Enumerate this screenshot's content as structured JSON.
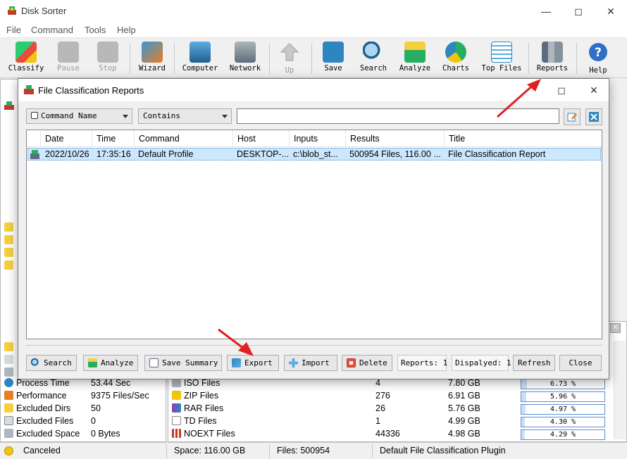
{
  "window": {
    "title": "Disk Sorter"
  },
  "menu": [
    "File",
    "Command",
    "Tools",
    "Help"
  ],
  "toolbar": [
    {
      "label": "Classify",
      "icon": "classify-icon",
      "enabled": true
    },
    {
      "label": "Pause",
      "icon": "pause-icon",
      "enabled": false
    },
    {
      "label": "Stop",
      "icon": "stop-icon",
      "enabled": false
    },
    {
      "label": "Wizard",
      "icon": "wizard-icon",
      "enabled": true
    },
    {
      "label": "Computer",
      "icon": "computer-icon",
      "enabled": true
    },
    {
      "label": "Network",
      "icon": "network-icon",
      "enabled": true
    },
    {
      "label": "Up",
      "icon": "up-arrow-icon",
      "enabled": false
    },
    {
      "label": "Save",
      "icon": "save-icon",
      "enabled": true
    },
    {
      "label": "Search",
      "icon": "search-icon",
      "enabled": true
    },
    {
      "label": "Analyze",
      "icon": "analyze-icon",
      "enabled": true
    },
    {
      "label": "Charts",
      "icon": "charts-icon",
      "enabled": true
    },
    {
      "label": "Top Files",
      "icon": "top-files-icon",
      "enabled": true
    },
    {
      "label": "Reports",
      "icon": "reports-icon",
      "enabled": true
    },
    {
      "label": "Help",
      "icon": "help-icon",
      "enabled": true
    }
  ],
  "stats": [
    {
      "label": "Process Time",
      "value": "53.44 Sec"
    },
    {
      "label": "Performance",
      "value": "9375 Files/Sec"
    },
    {
      "label": "Excluded Dirs",
      "value": "50"
    },
    {
      "label": "Excluded Files",
      "value": "0"
    },
    {
      "label": "Excluded Space",
      "value": "0 Bytes"
    }
  ],
  "categories": [
    {
      "name": "ISO Files",
      "files": "4",
      "space": "7.80 GB",
      "percent": "6.73 %",
      "fraction": 0.0673
    },
    {
      "name": "ZIP Files",
      "files": "276",
      "space": "6.91 GB",
      "percent": "5.96 %",
      "fraction": 0.0596
    },
    {
      "name": "RAR Files",
      "files": "26",
      "space": "5.76 GB",
      "percent": "4.97 %",
      "fraction": 0.0497
    },
    {
      "name": "TD Files",
      "files": "1",
      "space": "4.99 GB",
      "percent": "4.30 %",
      "fraction": 0.043
    },
    {
      "name": "NOEXT Files",
      "files": "44336",
      "space": "4.98 GB",
      "percent": "4.29 %",
      "fraction": 0.0429
    }
  ],
  "status": {
    "state": "Canceled",
    "space": "Space: 116.00 GB",
    "files": "Files: 500954",
    "plugin": "Default File Classification Plugin"
  },
  "dialog": {
    "title": "File Classification Reports",
    "filter_field": "Command Name",
    "filter_mode": "Contains",
    "filter_value": "",
    "columns": [
      "Date",
      "Time",
      "Command",
      "Host",
      "Inputs",
      "Results",
      "Title"
    ],
    "rows": [
      {
        "date": "2022/10/26",
        "time": "17:35:16",
        "command": "Default Profile",
        "host": "DESKTOP-...",
        "inputs": "c:\\blob_st...",
        "results": "500954 Files, 116.00 ...",
        "title": "File Classification Report"
      }
    ],
    "buttons": {
      "search": "Search",
      "analyze": "Analyze",
      "save_summary": "Save Summary",
      "export": "Export",
      "import": "Import",
      "delete": "Delete",
      "refresh": "Refresh",
      "close": "Close"
    },
    "reports_count": "Reports: 1",
    "displayed_count": "Dispalyed: 1"
  },
  "colors": {
    "selection": "#cce8ff",
    "accent_red": "#e02020",
    "progress_border": "#5b8fd0"
  }
}
